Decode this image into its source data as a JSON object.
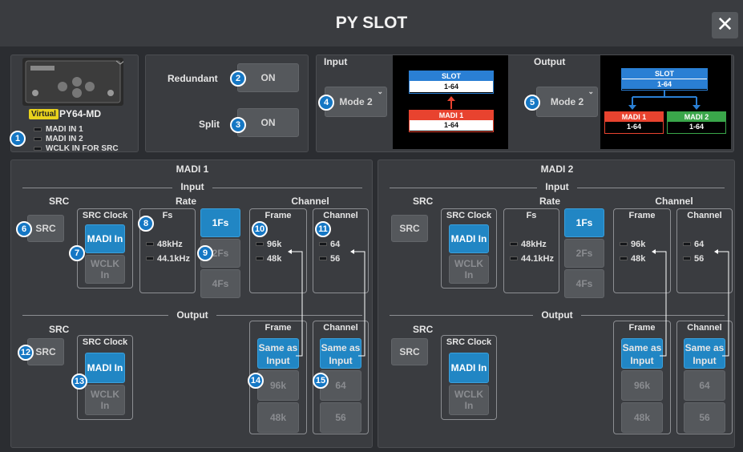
{
  "title": "PY SLOT",
  "close_glyph": "✕",
  "card": {
    "virtual_badge": "Virtual",
    "model": "PY64-MD",
    "status": [
      "MADI IN 1",
      "MADI IN 2",
      "WCLK IN FOR SRC"
    ]
  },
  "redundant": {
    "label": "Redundant",
    "value": "ON"
  },
  "split": {
    "label": "Split",
    "value": "ON"
  },
  "input_mode": {
    "label": "Input",
    "mode": "Mode 2",
    "slot": "SLOT",
    "slot_range": "1-64",
    "madi1": "MADI 1",
    "madi1_range": "1-64"
  },
  "output_mode": {
    "label": "Output",
    "mode": "Mode 2",
    "slot": "SLOT",
    "slot_range": "1-64",
    "madi1": "MADI 1",
    "madi1_range": "1-64",
    "madi2": "MADI 2",
    "madi2_range": "1-64"
  },
  "madi": [
    {
      "title": "MADI 1",
      "input": "Input",
      "output": "Output",
      "src": "SRC",
      "src_btn": "SRC",
      "src_clock": "SRC Clock",
      "madi_in": "MADI In",
      "wclk_in": "WCLK In",
      "rate": "Rate",
      "fs": "Fs",
      "fs_48": "48kHz",
      "fs_44": "44.1kHz",
      "fs_1": "1Fs",
      "fs_2": "2Fs",
      "fs_4": "4Fs",
      "channel_hdr": "Channel",
      "frame": "Frame",
      "frame_96": "96k",
      "frame_48": "48k",
      "channel": "Channel",
      "ch_64": "64",
      "ch_56": "56",
      "same_as": "Same as",
      "input_word": "Input",
      "out_96": "96k",
      "out_48": "48k",
      "out_64": "64",
      "out_56": "56"
    },
    {
      "title": "MADI 2",
      "input": "Input",
      "output": "Output",
      "src": "SRC",
      "src_btn": "SRC",
      "src_clock": "SRC Clock",
      "madi_in": "MADI In",
      "wclk_in": "WCLK In",
      "rate": "Rate",
      "fs": "Fs",
      "fs_48": "48kHz",
      "fs_44": "44.1kHz",
      "fs_1": "1Fs",
      "fs_2": "2Fs",
      "fs_4": "4Fs",
      "channel_hdr": "Channel",
      "frame": "Frame",
      "frame_96": "96k",
      "frame_48": "48k",
      "channel": "Channel",
      "ch_64": "64",
      "ch_56": "56",
      "same_as": "Same as",
      "input_word": "Input",
      "out_96": "96k",
      "out_48": "48k",
      "out_64": "64",
      "out_56": "56"
    }
  ],
  "badges": [
    "1",
    "2",
    "3",
    "4",
    "5",
    "6",
    "7",
    "8",
    "9",
    "10",
    "11",
    "12",
    "13",
    "14",
    "15"
  ],
  "colors": {
    "accent": "#2186c4",
    "madi1": "#e8432f",
    "madi2": "#3aa64a",
    "slot": "#2a7fd4",
    "badge": "#1577c4"
  }
}
